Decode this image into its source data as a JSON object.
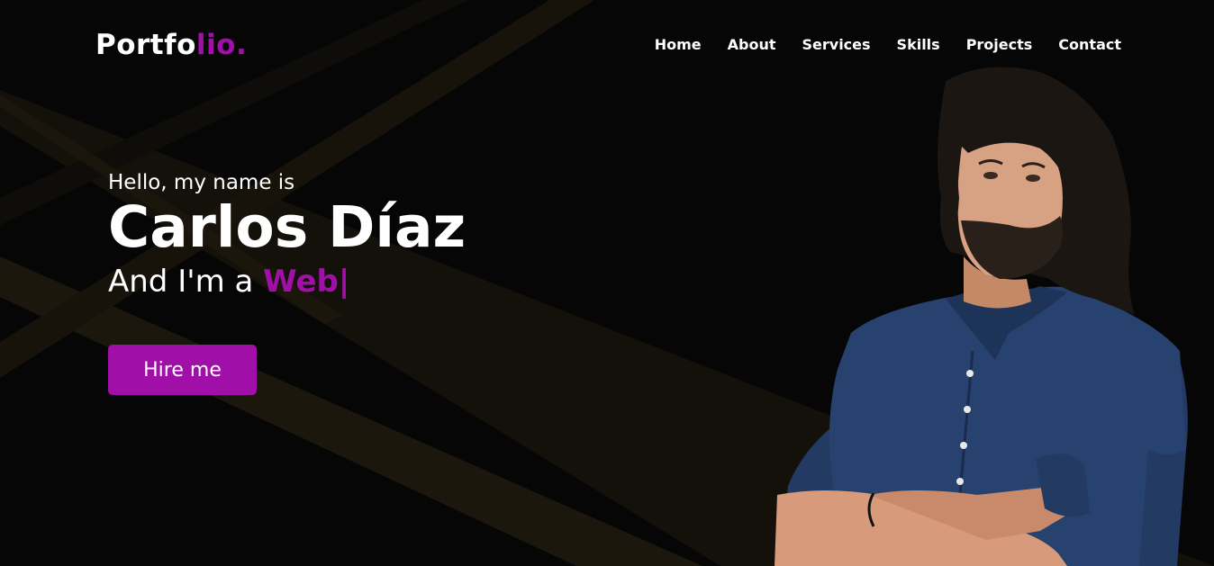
{
  "brand": {
    "logo_main": "Portfo",
    "logo_accent": "lio."
  },
  "nav": {
    "items": [
      {
        "label": "Home"
      },
      {
        "label": "About"
      },
      {
        "label": "Services"
      },
      {
        "label": "Skills"
      },
      {
        "label": "Projects"
      },
      {
        "label": "Contact"
      }
    ]
  },
  "hero": {
    "greeting": "Hello, my name is",
    "name": "Carlos Díaz",
    "role_prefix": "And I'm a ",
    "role_typed": "Web|",
    "cta_label": "Hire me"
  },
  "colors": {
    "accent": "#a010a8",
    "background": "#060606",
    "ray": "#2a2110"
  },
  "icons": {
    "portrait": "person-photo"
  }
}
